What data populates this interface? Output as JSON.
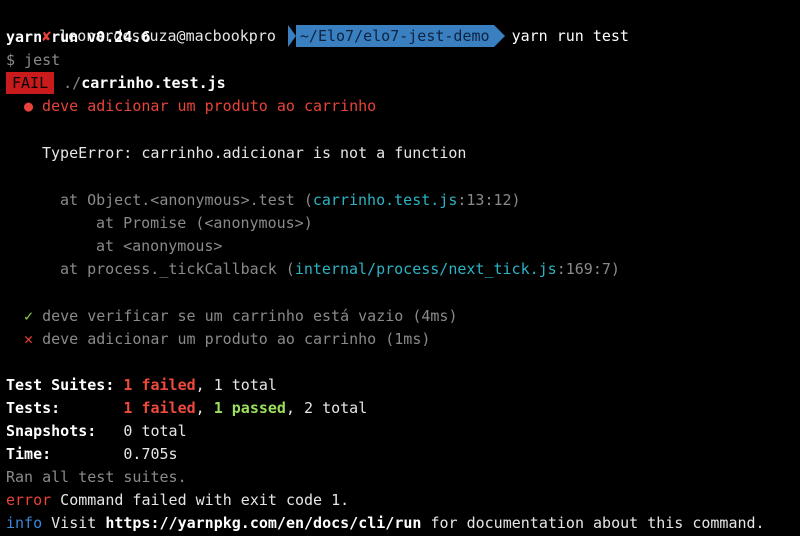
{
  "prompt": {
    "status_icon": "x-mark-icon",
    "user_host": "leonardosouza@macbookpro",
    "path": "~/Elo7/elo7-jest-demo",
    "command": "yarn run test"
  },
  "yarn_version": "yarn run v0.24.6",
  "jest_cmd": "$ jest",
  "fail_badge": "FAIL",
  "test_file_prefix": "./",
  "test_file_name": "carrinho.test.js",
  "failed_test_title": "● deve adicionar um produto ao carrinho",
  "error_message": "TypeError: carrinho.adicionar is not a function",
  "stack": [
    {
      "text": "at Object.<anonymous>.test (",
      "link": "carrinho.test.js",
      "suffix": ":13:12)"
    },
    {
      "text": "at Promise (<anonymous>)"
    },
    {
      "text": "at <anonymous>"
    },
    {
      "text": "at process._tickCallback (",
      "link": "internal/process/next_tick.js",
      "suffix": ":169:7)"
    }
  ],
  "results": [
    {
      "icon": "✓",
      "text": "deve verificar se um carrinho está vazio (4ms)",
      "status": "passed"
    },
    {
      "icon": "✕",
      "text": "deve adicionar um produto ao carrinho (1ms)",
      "status": "failed"
    }
  ],
  "summary": {
    "suites_label": "Test Suites: ",
    "suites_failed": "1 failed",
    "suites_total": ", 1 total",
    "tests_label": "Tests:       ",
    "tests_failed": "1 failed",
    "tests_sep": ", ",
    "tests_passed": "1 passed",
    "tests_total": ", 2 total",
    "snapshots_label": "Snapshots:   ",
    "snapshots_value": "0 total",
    "time_label": "Time:        ",
    "time_value": "0.705s",
    "ran_all": "Ran all test suites."
  },
  "error_line": {
    "tag": "error",
    "text": " Command failed with exit code 1."
  },
  "info_line": {
    "tag": "info",
    "prefix": " Visit ",
    "url": "https://yarnpkg.com/en/docs/cli/run",
    "suffix": " for documentation about this command."
  },
  "colors": {
    "background": "#000000",
    "fail": "#e8433a",
    "pass": "#8bd44a",
    "link": "#2bb3c4",
    "path_segment": "#3a7fc0",
    "info": "#3b86d6"
  }
}
